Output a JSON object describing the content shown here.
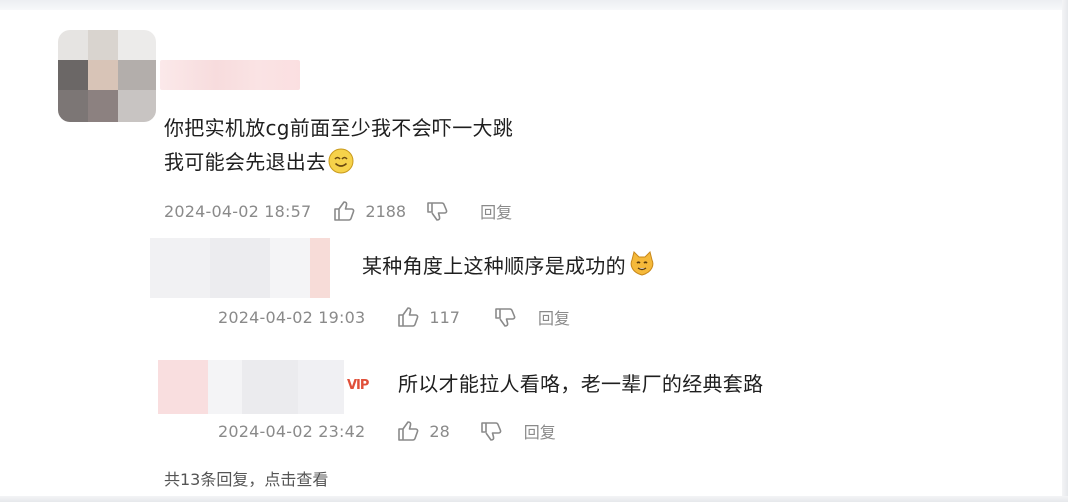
{
  "comments": [
    {
      "text_lines": [
        "你把实机放cg前面至少我不会吓一大跳",
        "我可能会先退出去"
      ],
      "emoji": "smile-emoji",
      "time": "2024-04-02 18:57",
      "likes": "2188",
      "reply_label": "回复"
    },
    {
      "text_lines": [
        "某种角度上这种顺序是成功的"
      ],
      "emoji": "cat-emoji",
      "time": "2024-04-02 19:03",
      "likes": "117",
      "reply_label": "回复"
    },
    {
      "text_lines": [
        "所以才能拉人看咯，老一辈厂的经典套路"
      ],
      "badge": "VIP",
      "time": "2024-04-02 23:42",
      "likes": "28",
      "reply_label": "回复"
    }
  ],
  "footer": {
    "more_replies": "共13条回复，点击查看"
  },
  "colors": {
    "text": "#1f1f1f",
    "meta": "#8a8a8a",
    "badge": "#e0503a"
  },
  "icons": {
    "like": "thumbs-up-icon",
    "dislike": "thumbs-down-icon"
  }
}
